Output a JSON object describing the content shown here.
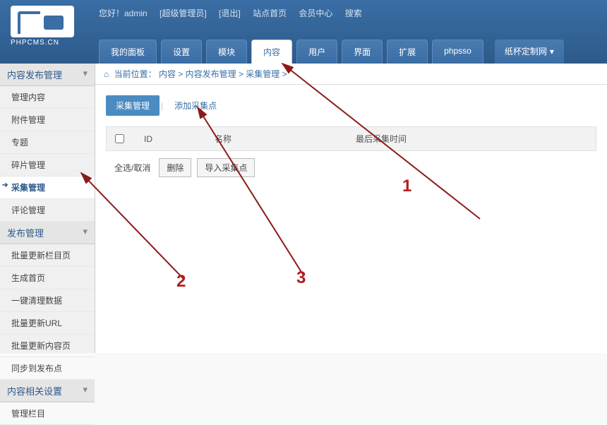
{
  "logo_text": "PHPCMS.CN",
  "topbar": {
    "greeting": "您好！admin",
    "role": "[超级管理员]",
    "logout": "[退出]",
    "site_home": "站点首页",
    "member_center": "会员中心",
    "search": "搜索"
  },
  "nav": {
    "tabs": [
      "我的面板",
      "设置",
      "模块",
      "内容",
      "用户",
      "界面",
      "扩展",
      "phpsso"
    ],
    "active": 3,
    "site": "纸杯定制网"
  },
  "sidebar": {
    "groups": [
      {
        "title": "内容发布管理",
        "items": [
          "管理内容",
          "附件管理",
          "专题",
          "碎片管理",
          "采集管理",
          "评论管理"
        ],
        "active": 4
      },
      {
        "title": "发布管理",
        "items": [
          "批量更新栏目页",
          "生成首页",
          "一键清理数据",
          "批量更新URL",
          "批量更新内容页",
          "同步到发布点"
        ]
      },
      {
        "title": "内容相关设置",
        "items": [
          "管理栏目"
        ]
      }
    ]
  },
  "breadcrumb": {
    "icon": "⌂",
    "label": "当前位置：",
    "path": "内容 > 内容发布管理 > 采集管理 >"
  },
  "subtabs": {
    "active": "采集管理",
    "add": "添加采集点"
  },
  "table": {
    "col_id": "ID",
    "col_name": "名称",
    "col_time": "最后采集时间"
  },
  "actions": {
    "select_all": "全选/取消",
    "delete": "删除",
    "import": "导入采集点"
  },
  "annotations": {
    "a1": "1",
    "a2": "2",
    "a3": "3"
  }
}
